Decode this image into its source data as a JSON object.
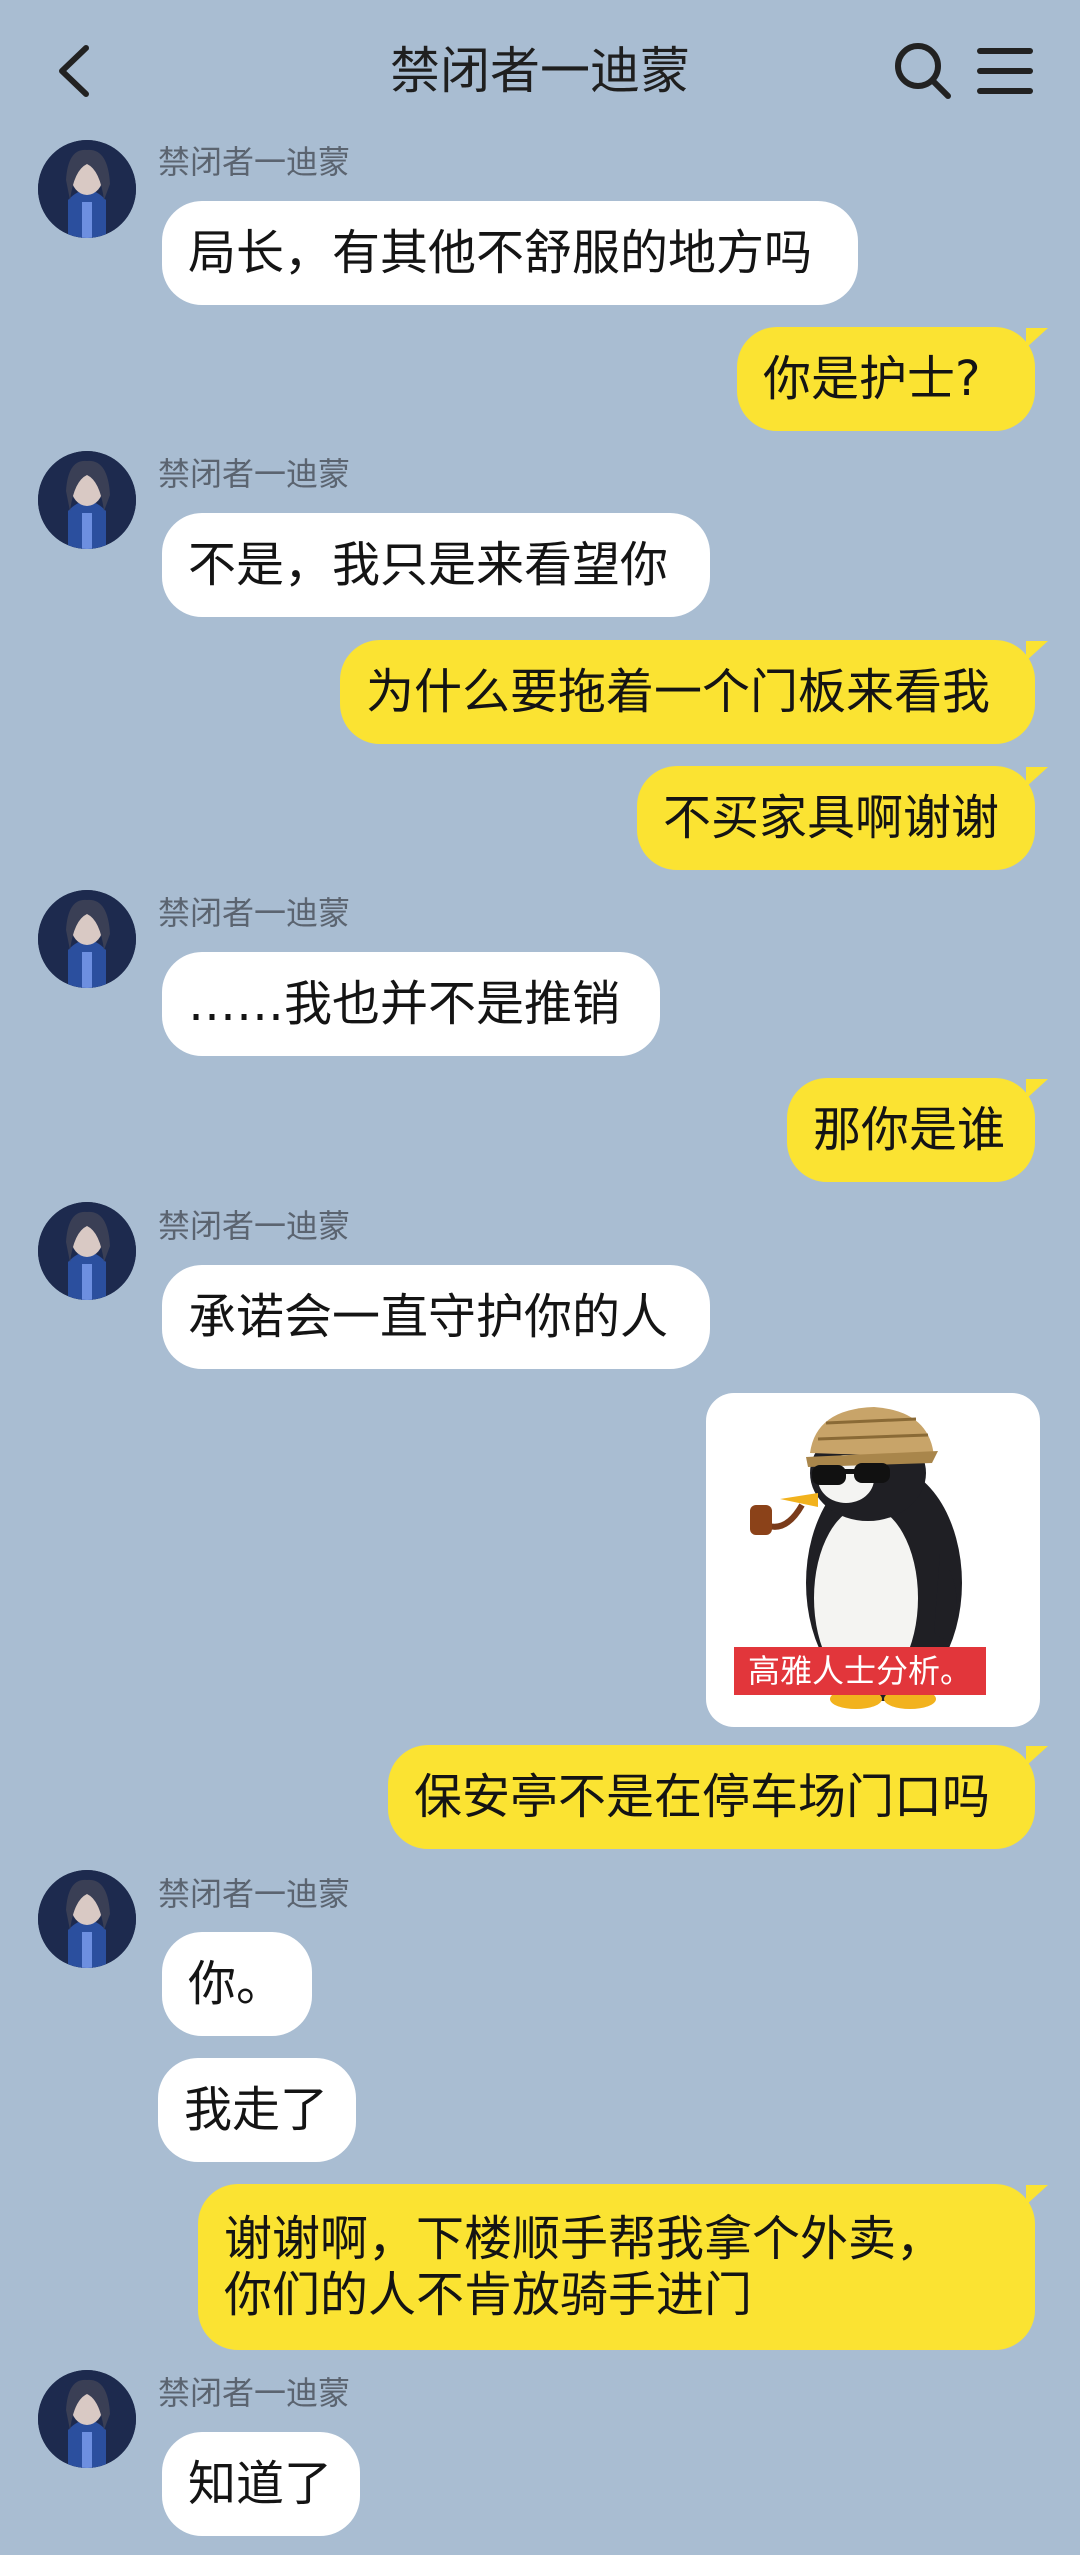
{
  "header": {
    "title": "禁闭者一迪蒙"
  },
  "contact": {
    "name": "禁闭者一迪蒙"
  },
  "messages": {
    "m1": "局长，有其他不舒服的地方吗",
    "m2": "你是护士?",
    "m3": "不是，我只是来看望你",
    "m4": "为什么要拖着一个门板来看我",
    "m5": "不买家具啊谢谢",
    "m6": "……我也并不是推销",
    "m7": "那你是谁",
    "m8": "承诺会一直守护你的人",
    "sticker_caption": "高雅人士分析。",
    "m9": "保安亭不是在停车场门口吗",
    "m10": "你。",
    "m11": "我走了",
    "m12_line1": "谢谢啊，下楼顺手帮我拿个外卖，",
    "m12_line2": "你们的人不肯放骑手进门",
    "m13": "知道了"
  },
  "colors": {
    "background": "#a9bdd2",
    "outgoing_bubble": "#fbe332",
    "incoming_bubble": "#ffffff"
  },
  "icons": [
    "back-arrow-icon",
    "search-icon",
    "menu-icon",
    "avatar",
    "penguin-sticker"
  ]
}
